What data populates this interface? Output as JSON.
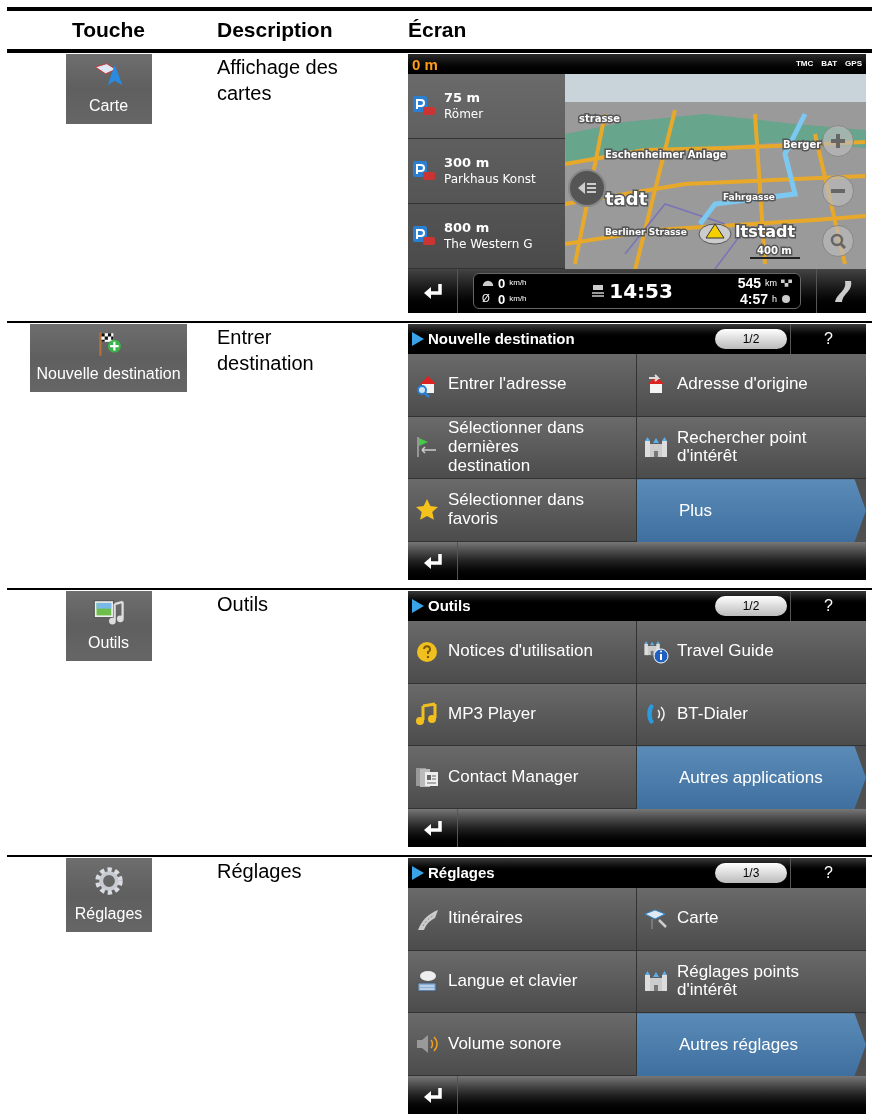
{
  "table": {
    "columns": [
      "Touche",
      "Description",
      "Écran"
    ],
    "rows": [
      {
        "key": {
          "label": "Carte"
        },
        "description": "Affichage des cartes",
        "screen": {
          "kind": "map",
          "distance": "0 m",
          "status": [
            "TMC",
            "BAT",
            "GPS"
          ],
          "parking": [
            {
              "distance": "75 m",
              "name": "Römer"
            },
            {
              "distance": "300 m",
              "name": "Parkhaus Konst"
            },
            {
              "distance": "800 m",
              "name": "The Western G"
            }
          ],
          "map_labels": [
            "strasse",
            "Eschenheimer Anlage",
            "Berger",
            "tadt",
            "Fahrgasse",
            "Berliner Strasse",
            "ltstadt",
            "400 m"
          ],
          "speed": {
            "value": "0",
            "unit": "km/h"
          },
          "average": {
            "symbol": "Ø",
            "value": "0",
            "unit": "km/h"
          },
          "arrival": "14:53",
          "remaining": {
            "value": "545",
            "unit": "km"
          },
          "duration": {
            "value": "4:57",
            "unit": "h"
          }
        }
      },
      {
        "key": {
          "label": "Nouvelle destination"
        },
        "description": "Entrer destination",
        "screen": {
          "kind": "menu",
          "title": "Nouvelle destination",
          "page": "1/2",
          "help": "?",
          "items": [
            {
              "label": "Entrer l'adresse",
              "kind": "item"
            },
            {
              "label": "Adresse d'origine",
              "kind": "item"
            },
            {
              "label": "Sélectionner dans dernières destination",
              "kind": "item"
            },
            {
              "label": "Rechercher point d'intérêt",
              "kind": "item"
            },
            {
              "label": "Sélectionner dans favoris",
              "kind": "item"
            },
            {
              "label": "Plus",
              "kind": "more"
            }
          ]
        }
      },
      {
        "key": {
          "label": "Outils"
        },
        "description": "Outils",
        "screen": {
          "kind": "menu",
          "title": "Outils",
          "page": "1/2",
          "help": "?",
          "items": [
            {
              "label": "Notices d'utilisation",
              "kind": "item"
            },
            {
              "label": "Travel Guide",
              "kind": "item"
            },
            {
              "label": "MP3 Player",
              "kind": "item"
            },
            {
              "label": "BT-Dialer",
              "kind": "item"
            },
            {
              "label": "Contact Manager",
              "kind": "item"
            },
            {
              "label": "Autres applications",
              "kind": "more"
            }
          ]
        }
      },
      {
        "key": {
          "label": "Réglages"
        },
        "description": "Réglages",
        "screen": {
          "kind": "menu",
          "title": "Réglages",
          "page": "1/3",
          "help": "?",
          "items": [
            {
              "label": "Itinéraires",
              "kind": "item"
            },
            {
              "label": "Carte",
              "kind": "item"
            },
            {
              "label": "Langue et clavier",
              "kind": "item"
            },
            {
              "label": "Réglages points d'intérêt",
              "kind": "item"
            },
            {
              "label": "Volume sonore",
              "kind": "item"
            },
            {
              "label": "Autres réglages",
              "kind": "more"
            }
          ]
        }
      }
    ]
  }
}
